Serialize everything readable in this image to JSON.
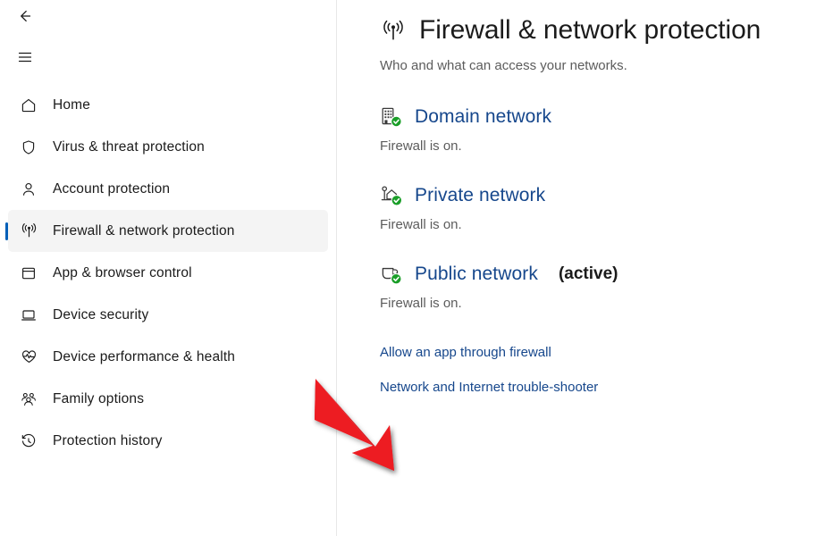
{
  "window": {
    "back_icon": "back-arrow-icon",
    "menu_icon": "hamburger-menu-icon"
  },
  "sidebar": {
    "items": [
      {
        "label": "Home",
        "icon": "home-icon",
        "selected": false
      },
      {
        "label": "Virus & threat protection",
        "icon": "shield-icon",
        "selected": false
      },
      {
        "label": "Account protection",
        "icon": "person-icon",
        "selected": false
      },
      {
        "label": "Firewall & network protection",
        "icon": "broadcast-icon",
        "selected": true
      },
      {
        "label": "App & browser control",
        "icon": "window-icon",
        "selected": false
      },
      {
        "label": "Device security",
        "icon": "laptop-icon",
        "selected": false
      },
      {
        "label": "Device performance & health",
        "icon": "heart-pulse-icon",
        "selected": false
      },
      {
        "label": "Family options",
        "icon": "people-icon",
        "selected": false
      },
      {
        "label": "Protection history",
        "icon": "history-clock-icon",
        "selected": false
      }
    ]
  },
  "main": {
    "title": "Firewall & network protection",
    "title_icon": "broadcast-icon",
    "subtitle": "Who and what can access your networks.",
    "sections": [
      {
        "name": "Domain network",
        "icon": "building-icon",
        "badge": "green-check-badge",
        "active_label": "",
        "status": "Firewall is on."
      },
      {
        "name": "Private network",
        "icon": "home-network-icon",
        "badge": "green-check-badge",
        "active_label": "",
        "status": "Firewall is on."
      },
      {
        "name": "Public network",
        "icon": "coffee-cup-icon",
        "badge": "green-check-badge",
        "active_label": "(active)",
        "status": "Firewall is on."
      }
    ],
    "links": [
      {
        "label": "Allow an app through firewall"
      },
      {
        "label": "Network and Internet trouble-shooter"
      }
    ]
  },
  "annotation": {
    "type": "red-arrow",
    "color": "#ed1c24",
    "points_to": "Allow an app through firewall"
  },
  "colors": {
    "link_blue": "#16478c",
    "accent": "#005fb8",
    "badge_green": "#1a9e28",
    "arrow_red": "#ed1c24",
    "text_primary": "#1b1b1b",
    "text_secondary": "#5c5c5c",
    "selected_bg": "#f4f4f4"
  }
}
